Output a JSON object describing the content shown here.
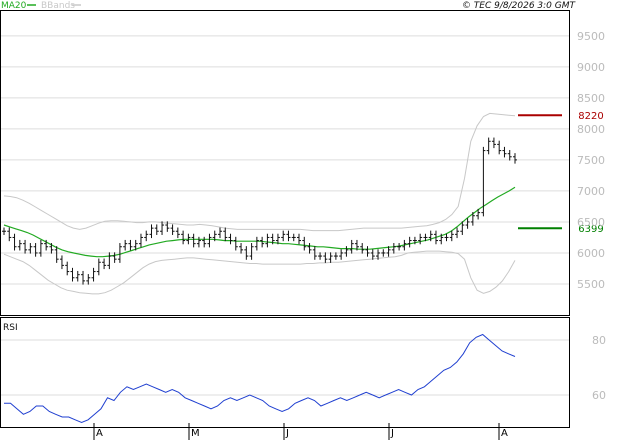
{
  "header": {
    "legend_ma": "MA20",
    "legend_bbands": "BBands",
    "copyright": "© TEC 9/8/2026 3:0 GMT"
  },
  "rsi_panel": {
    "label": "RSI"
  },
  "colors": {
    "ma": "#22aa22",
    "bbands": "#c8c8c8",
    "price": "#111111",
    "rsi": "#1f3fd0",
    "resistance": "#aa0000",
    "support": "#008000",
    "grid": "#dddddd",
    "axis_text": "#bbbbbb"
  },
  "chart_data": [
    {
      "type": "candlestick",
      "title": "",
      "x_ticks": [
        "A",
        "M",
        "J",
        "J",
        "A"
      ],
      "y_ticks": [
        5500,
        6000,
        6500,
        7000,
        7500,
        8000,
        8500,
        9000,
        9500
      ],
      "ylim": [
        5000,
        9900
      ],
      "grid": true,
      "levels": [
        {
          "name": "resistance",
          "value": 8220,
          "label": "8220"
        },
        {
          "name": "support",
          "value": 6399,
          "label": "6399"
        }
      ],
      "close": [
        6350,
        6250,
        6100,
        6150,
        6050,
        6100,
        6000,
        6150,
        6100,
        6050,
        5900,
        5800,
        5700,
        5600,
        5650,
        5550,
        5600,
        5700,
        5850,
        5800,
        5950,
        5900,
        6100,
        6150,
        6100,
        6150,
        6250,
        6300,
        6400,
        6350,
        6450,
        6400,
        6350,
        6300,
        6200,
        6250,
        6150,
        6200,
        6150,
        6250,
        6300,
        6350,
        6250,
        6200,
        6100,
        6050,
        5950,
        6100,
        6200,
        6150,
        6250,
        6200,
        6250,
        6300,
        6250,
        6250,
        6200,
        6100,
        6050,
        5950,
        5950,
        5900,
        5950,
        5950,
        6000,
        6050,
        6150,
        6100,
        6050,
        6000,
        5950,
        6000,
        6000,
        6050,
        6100,
        6100,
        6150,
        6200,
        6200,
        6250,
        6250,
        6300,
        6200,
        6250,
        6250,
        6300,
        6350,
        6450,
        6500,
        6600,
        6650,
        7650,
        7800,
        7750,
        7650,
        7600,
        7550,
        7500
      ],
      "ma20": [
        6450,
        6420,
        6390,
        6360,
        6330,
        6290,
        6240,
        6190,
        6140,
        6090,
        6050,
        6020,
        6000,
        5980,
        5960,
        5950,
        5940,
        5940,
        5950,
        5960,
        5980,
        6010,
        6040,
        6070,
        6100,
        6130,
        6150,
        6170,
        6190,
        6200,
        6210,
        6220,
        6220,
        6220,
        6220,
        6220,
        6220,
        6210,
        6200,
        6200,
        6190,
        6190,
        6190,
        6190,
        6190,
        6180,
        6170,
        6160,
        6150,
        6150,
        6140,
        6130,
        6120,
        6110,
        6100,
        6100,
        6090,
        6080,
        6070,
        6070,
        6070,
        6060,
        6060,
        6060,
        6070,
        6080,
        6090,
        6100,
        6110,
        6130,
        6150,
        6170,
        6190,
        6210,
        6240,
        6270,
        6300,
        6350,
        6420,
        6500,
        6580,
        6650,
        6720,
        6780,
        6840,
        6900,
        6950,
        7000,
        7060
      ],
      "bb_upper": [
        6920,
        6910,
        6890,
        6850,
        6800,
        6740,
        6680,
        6620,
        6560,
        6500,
        6440,
        6400,
        6380,
        6400,
        6440,
        6480,
        6510,
        6520,
        6520,
        6510,
        6500,
        6490,
        6490,
        6500,
        6500,
        6490,
        6480,
        6470,
        6460,
        6450,
        6450,
        6460,
        6450,
        6440,
        6420,
        6400,
        6390,
        6380,
        6380,
        6380,
        6380,
        6380,
        6380,
        6380,
        6380,
        6380,
        6380,
        6380,
        6370,
        6360,
        6360,
        6360,
        6360,
        6360,
        6370,
        6380,
        6390,
        6400,
        6400,
        6400,
        6400,
        6400,
        6400,
        6400,
        6410,
        6420,
        6430,
        6440,
        6460,
        6490,
        6540,
        6620,
        6750,
        7200,
        7800,
        8050,
        8200,
        8250,
        8240,
        8230,
        8220,
        8210
      ],
      "bb_lower": [
        5980,
        5940,
        5900,
        5860,
        5800,
        5720,
        5640,
        5560,
        5500,
        5440,
        5400,
        5380,
        5360,
        5350,
        5340,
        5340,
        5360,
        5400,
        5460,
        5520,
        5600,
        5680,
        5760,
        5820,
        5860,
        5880,
        5890,
        5900,
        5910,
        5920,
        5920,
        5910,
        5900,
        5890,
        5880,
        5870,
        5860,
        5850,
        5840,
        5830,
        5830,
        5820,
        5820,
        5820,
        5820,
        5820,
        5820,
        5820,
        5830,
        5830,
        5840,
        5840,
        5850,
        5850,
        5860,
        5870,
        5880,
        5890,
        5900,
        5910,
        5920,
        5930,
        5940,
        5960,
        6000,
        6010,
        6020,
        6030,
        6030,
        6030,
        6020,
        6010,
        5990,
        5900,
        5600,
        5400,
        5350,
        5380,
        5450,
        5550,
        5700,
        5880
      ]
    },
    {
      "type": "line",
      "title": "RSI",
      "y_ticks": [
        60,
        80
      ],
      "ylim": [
        48,
        88
      ],
      "grid": true,
      "series": [
        {
          "name": "",
          "values": [
            57,
            57,
            55,
            53,
            54,
            56,
            56,
            54,
            53,
            52,
            52,
            51,
            50,
            51,
            53,
            55,
            59,
            58,
            61,
            63,
            62,
            63,
            64,
            63,
            62,
            61,
            62,
            61,
            59,
            58,
            57,
            56,
            55,
            56,
            58,
            59,
            58,
            59,
            60,
            59,
            58,
            56,
            55,
            54,
            55,
            57,
            58,
            59,
            58,
            56,
            57,
            58,
            59,
            58,
            59,
            60,
            61,
            60,
            59,
            60,
            61,
            62,
            61,
            60,
            62,
            63,
            65,
            67,
            69,
            70,
            72,
            75,
            79,
            81,
            82,
            80,
            78,
            76,
            75,
            74
          ]
        }
      ]
    }
  ]
}
